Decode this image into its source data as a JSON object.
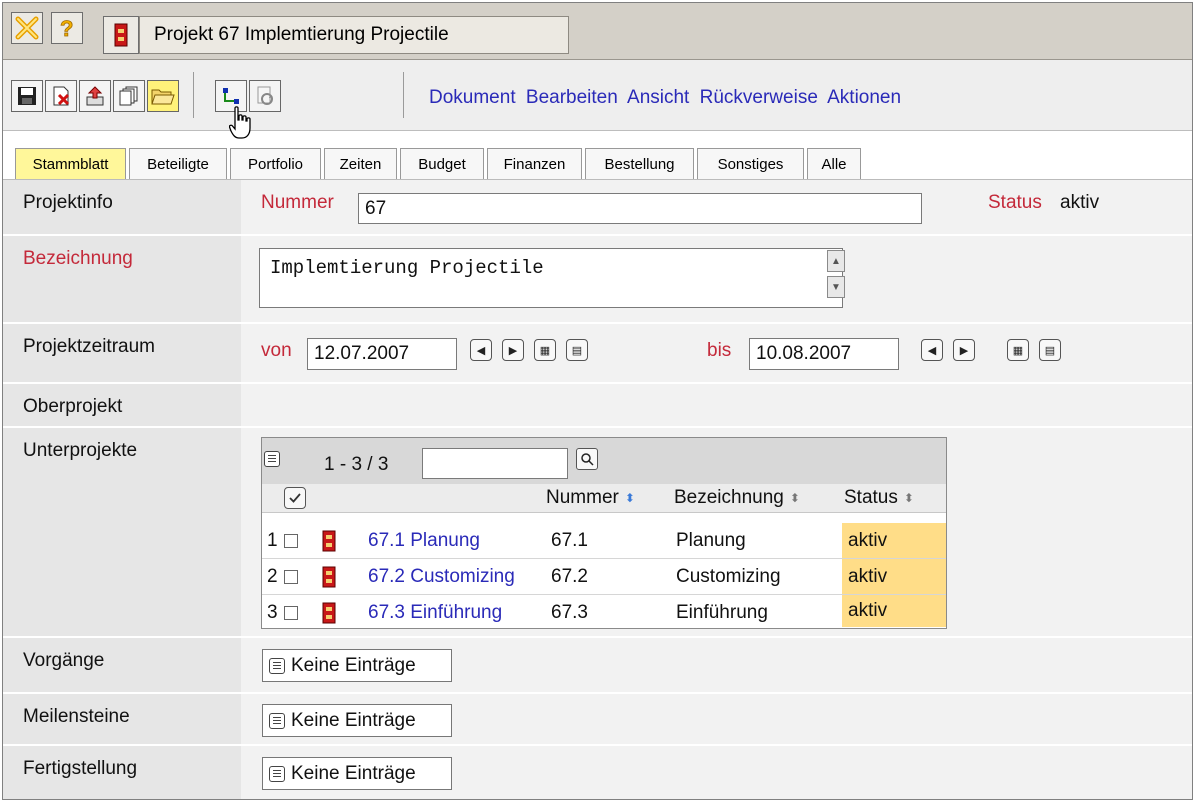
{
  "window": {
    "title": "Projekt 67 Implemtierung Projectile",
    "close_icon": "x-close-icon",
    "help_icon": "question-help-icon"
  },
  "toolbar": {
    "icons": [
      "save-icon",
      "delete-document-icon",
      "export-icon",
      "copy-icon",
      "open-folder-icon",
      "hierarchy-icon",
      "refresh-icon"
    ],
    "menu": [
      "Dokument",
      "Bearbeiten",
      "Ansicht",
      "Rückverweise",
      "Aktionen"
    ],
    "link_color": "#2a2ab8"
  },
  "tabs": [
    {
      "label": "Stammblatt",
      "active": true
    },
    {
      "label": "Beteiligte",
      "active": false
    },
    {
      "label": "Portfolio",
      "active": false
    },
    {
      "label": "Zeiten",
      "active": false
    },
    {
      "label": "Budget",
      "active": false
    },
    {
      "label": "Finanzen",
      "active": false
    },
    {
      "label": "Bestellung",
      "active": false
    },
    {
      "label": "Sonstiges",
      "active": false
    },
    {
      "label": "Alle",
      "active": false
    }
  ],
  "form": {
    "projektinfo": {
      "label": "Projektinfo",
      "nummer_label": "Nummer",
      "nummer_value": "67",
      "status_label": "Status",
      "status_value": "aktiv"
    },
    "bezeichnung": {
      "label": "Bezeichnung",
      "value": "Implemtierung Projectile"
    },
    "zeitraum": {
      "label": "Projektzeitraum",
      "von_label": "von",
      "von_value": "12.07.2007",
      "bis_label": "bis",
      "bis_value": "10.08.2007"
    },
    "oberprojekt": {
      "label": "Oberprojekt"
    },
    "unterprojekte": {
      "label": "Unterprojekte",
      "range": "1 - 3 / 3",
      "filter_value": "",
      "columns": [
        "Nummer",
        "Bezeichnung",
        "Status"
      ],
      "rows": [
        {
          "index": "1",
          "link": "67.1 Planung",
          "nummer": "67.1",
          "bezeichnung": "Planung",
          "status": "aktiv"
        },
        {
          "index": "2",
          "link": "67.2 Customizing",
          "nummer": "67.2",
          "bezeichnung": "Customizing",
          "status": "aktiv"
        },
        {
          "index": "3",
          "link": "67.3 Einführung",
          "nummer": "67.3",
          "bezeichnung": "Einführung",
          "status": "aktiv"
        }
      ]
    },
    "vorgaenge": {
      "label": "Vorgänge",
      "value": "Keine Einträge"
    },
    "meilensteine": {
      "label": "Meilensteine",
      "value": "Keine Einträge"
    },
    "fertigstellung": {
      "label": "Fertigstellung",
      "value": "Keine Einträge"
    }
  },
  "colors": {
    "required_label": "#c4293a",
    "active_tab": "#fff79a",
    "status_highlight": "#ffdd88"
  }
}
